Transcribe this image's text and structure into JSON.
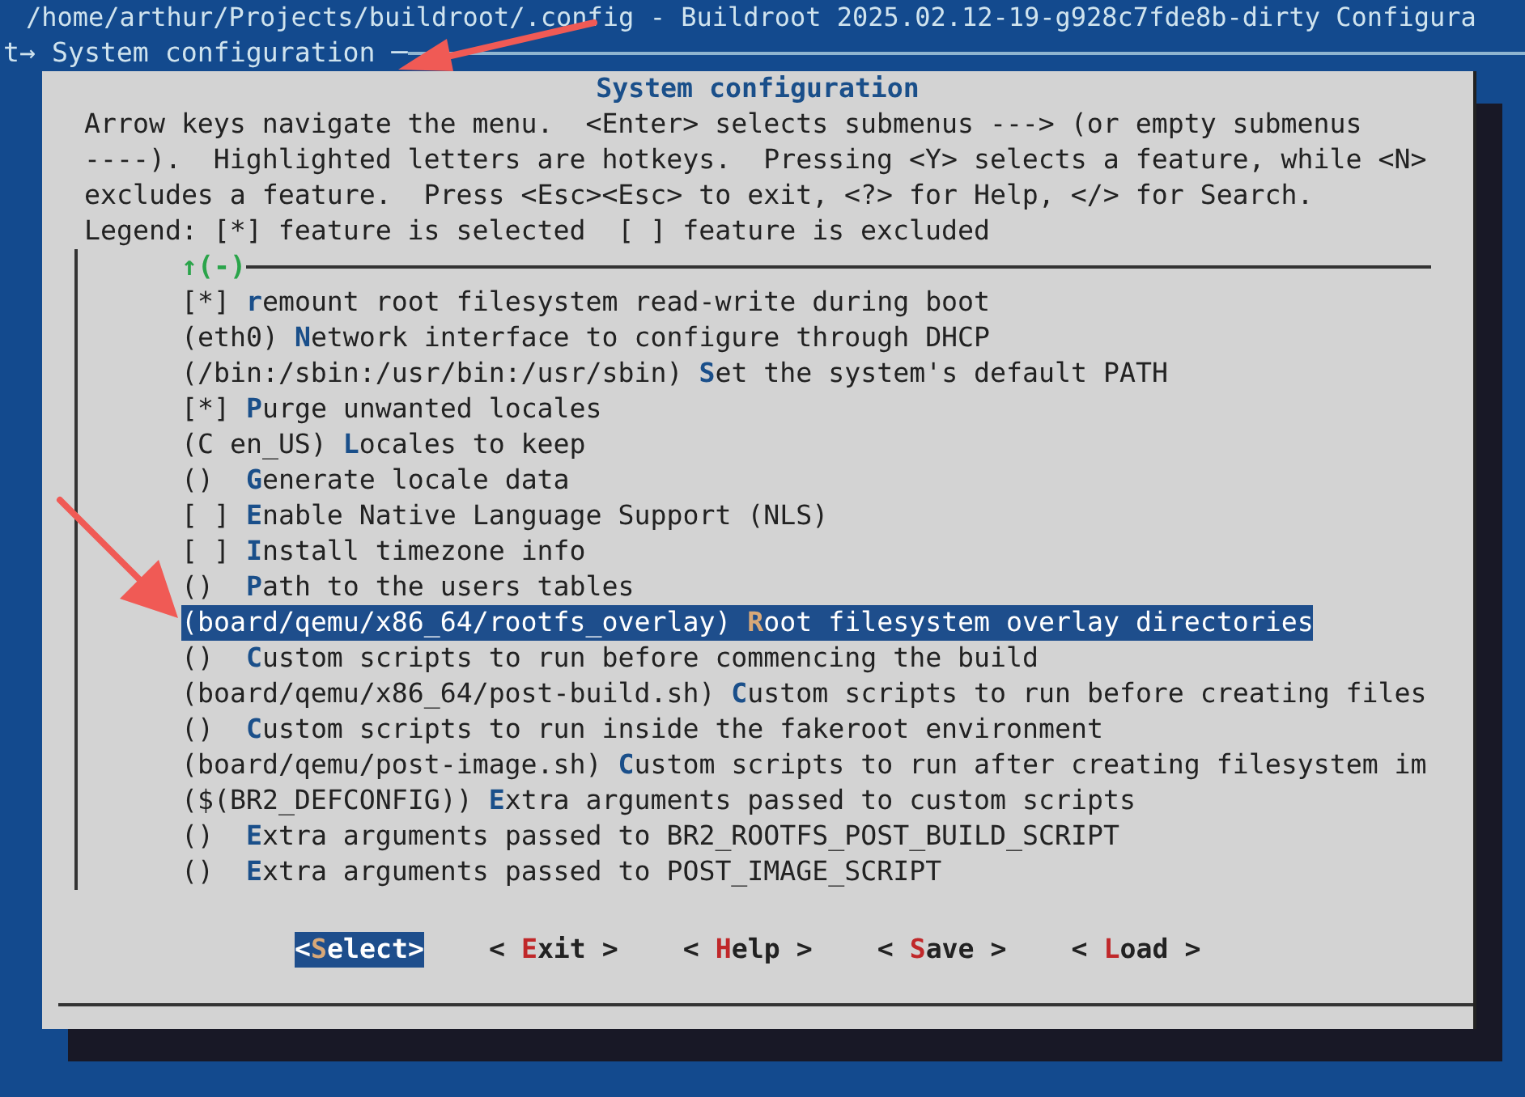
{
  "window": {
    "title": "/home/arthur/Projects/buildroot/.config - Buildroot 2025.02.12-19-g928c7fde8b-dirty Configura"
  },
  "breadcrumb": {
    "text": "t→ System configuration ─"
  },
  "dialog": {
    "title": "System configuration",
    "help_lines": [
      "Arrow keys navigate the menu.  <Enter> selects submenus ---> (or empty submenus",
      "----).  Highlighted letters are hotkeys.  Pressing <Y> selects a feature, while <N>",
      "excludes a feature.  Press <Esc><Esc> to exit, <?> for Help, </> for Search.",
      "Legend: [*] feature is selected  [ ] feature is excluded"
    ],
    "scroll_indicator": "↑(-)",
    "items": [
      {
        "prefix": "[*] ",
        "hotkey": "r",
        "text": "emount root filesystem read-write during boot",
        "selected": false
      },
      {
        "prefix": "(eth0) ",
        "hotkey": "N",
        "text": "etwork interface to configure through DHCP",
        "selected": false
      },
      {
        "prefix": "(/bin:/sbin:/usr/bin:/usr/sbin) ",
        "hotkey": "S",
        "text": "et the system's default PATH",
        "selected": false
      },
      {
        "prefix": "[*] ",
        "hotkey": "P",
        "text": "urge unwanted locales",
        "selected": false
      },
      {
        "prefix": "(C en_US) ",
        "hotkey": "L",
        "text": "ocales to keep",
        "selected": false
      },
      {
        "prefix": "()  ",
        "hotkey": "G",
        "text": "enerate locale data",
        "selected": false
      },
      {
        "prefix": "[ ] ",
        "hotkey": "E",
        "text": "nable Native Language Support (NLS)",
        "selected": false
      },
      {
        "prefix": "[ ] ",
        "hotkey": "I",
        "text": "nstall timezone info",
        "selected": false
      },
      {
        "prefix": "()  ",
        "hotkey": "P",
        "text": "ath to the users tables",
        "selected": false
      },
      {
        "prefix": "(board/qemu/x86_64/rootfs_overlay) ",
        "hotkey": "R",
        "text": "oot filesystem overlay directories",
        "selected": true
      },
      {
        "prefix": "()  ",
        "hotkey": "C",
        "text": "ustom scripts to run before commencing the build",
        "selected": false
      },
      {
        "prefix": "(board/qemu/x86_64/post-build.sh) ",
        "hotkey": "C",
        "text": "ustom scripts to run before creating files",
        "selected": false
      },
      {
        "prefix": "()  ",
        "hotkey": "C",
        "text": "ustom scripts to run inside the fakeroot environment",
        "selected": false
      },
      {
        "prefix": "(board/qemu/post-image.sh) ",
        "hotkey": "C",
        "text": "ustom scripts to run after creating filesystem im",
        "selected": false
      },
      {
        "prefix": "($(BR2_DEFCONFIG)) ",
        "hotkey": "E",
        "text": "xtra arguments passed to custom scripts",
        "selected": false
      },
      {
        "prefix": "()  ",
        "hotkey": "E",
        "text": "xtra arguments passed to BR2_ROOTFS_POST_BUILD_SCRIPT",
        "selected": false
      },
      {
        "prefix": "()  ",
        "hotkey": "E",
        "text": "xtra arguments passed to POST_IMAGE_SCRIPT",
        "selected": false
      }
    ],
    "buttons": [
      {
        "before": "<",
        "hotkey": "S",
        "after": "elect>",
        "selected": true
      },
      {
        "before": "< ",
        "hotkey": "E",
        "after": "xit >",
        "selected": false
      },
      {
        "before": "< ",
        "hotkey": "H",
        "after": "elp >",
        "selected": false
      },
      {
        "before": "< ",
        "hotkey": "S",
        "after": "ave >",
        "selected": false
      },
      {
        "before": "< ",
        "hotkey": "L",
        "after": "oad >",
        "selected": false
      }
    ]
  }
}
